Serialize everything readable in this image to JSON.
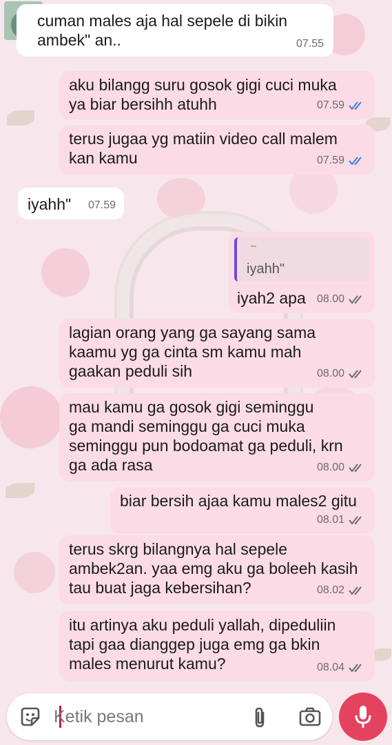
{
  "messages": [
    {
      "dir": "in",
      "text": "cuman males aja hal sepele di bikin\nambek\" an..",
      "time": "07.55"
    },
    {
      "dir": "out",
      "text": "aku bilangg suru gosok gigi cuci muka\nya biar bersihh atuhh",
      "time": "07.59",
      "status": "read"
    },
    {
      "dir": "out",
      "text": "terus jugaa yg matiin video call malem\nkan kamu",
      "time": "07.59",
      "status": "read"
    },
    {
      "dir": "in",
      "text": "iyahh\"",
      "time": "07.59"
    },
    {
      "dir": "out",
      "text": "iyah2 apa",
      "time": "08.00",
      "status": "delivered",
      "quoted_text": "iyahh\""
    },
    {
      "dir": "out",
      "text": "lagian orang yang ga sayang sama\nkaamu yg ga cinta sm kamu mah\ngaakan peduli sih",
      "time": "08.00",
      "status": "delivered"
    },
    {
      "dir": "out",
      "text": "mau kamu ga gosok gigi seminggu\nga mandi seminggu ga cuci muka\nseminggu pun bodoamat ga peduli, krn\nga ada rasa",
      "time": "08.00",
      "status": "delivered"
    },
    {
      "dir": "out",
      "text": "biar bersih ajaa kamu males2 gitu",
      "time": "08.01",
      "status": "delivered"
    },
    {
      "dir": "out",
      "text": "terus skrg bilangnya hal sepele\nambek2an. yaa emg aku ga boleeh kasih\ntau buat jaga kebersihan?",
      "time": "08.02",
      "status": "delivered"
    },
    {
      "dir": "out",
      "text": "itu artinya aku peduli yallah, dipeduliin\ntapi gaa dianggep juga emg ga bkin\nmales menurut kamu?",
      "time": "08.04",
      "status": "delivered"
    }
  ],
  "composer": {
    "placeholder": "Ketik pesan"
  },
  "icons": {
    "emoji": "sticker-icon",
    "attach": "paperclip-icon",
    "camera": "camera-icon",
    "mic": "microphone-icon",
    "read_ticks": "double-check-icon",
    "delivered_ticks": "double-check-icon"
  },
  "colors": {
    "outgoing_bubble": "#fbdbe6",
    "incoming_bubble": "#ffffff",
    "read_tick": "#3b82d6",
    "delivered_tick": "#6b6b6b",
    "mic_button": "#e3435f",
    "quote_bar": "#6a4bd8"
  }
}
